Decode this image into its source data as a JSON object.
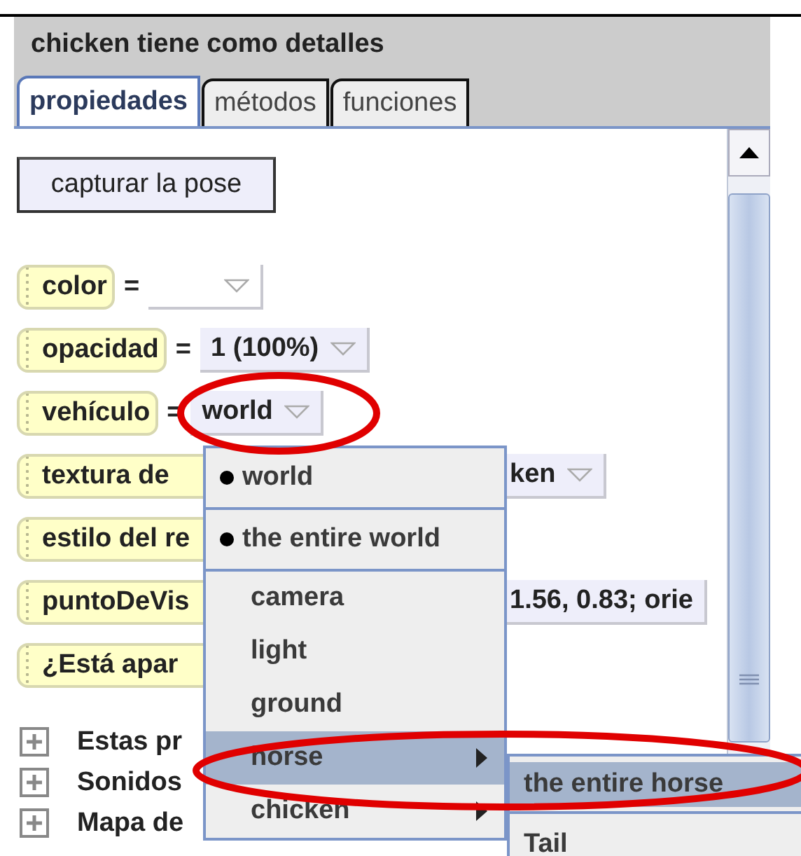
{
  "panel": {
    "title": "chicken tiene como detalles"
  },
  "tabs": [
    {
      "label": "propiedades",
      "selected": true
    },
    {
      "label": "métodos",
      "selected": false
    },
    {
      "label": "funciones",
      "selected": false
    }
  ],
  "capture_button": "capturar la pose",
  "properties": [
    {
      "name": "color",
      "equals": "=",
      "dropdown": true,
      "kind": "open"
    },
    {
      "name": "opacidad",
      "equals": "=",
      "value": "1 (100%)",
      "dropdown": true,
      "kind": "open"
    },
    {
      "name": "vehículo",
      "equals": "=",
      "value": "world",
      "dropdown": true,
      "kind": "open"
    },
    {
      "name": "textura de",
      "value": "ken",
      "dropdown": true,
      "kind": "covered"
    },
    {
      "name": "estilo del re",
      "dropdown": false,
      "kind": "covered"
    },
    {
      "name": "puntoDeVis",
      "value": "1.56, 0.83;  orie",
      "dropdown": false,
      "kind": "covered"
    },
    {
      "name": "¿Está apar",
      "dropdown": false,
      "kind": "covered"
    }
  ],
  "groups": [
    {
      "label": "Estas pr",
      "expanded": false
    },
    {
      "label": "Sonidos",
      "expanded": false
    },
    {
      "label": "Mapa de",
      "expanded": false
    }
  ],
  "menu": {
    "items": [
      {
        "label": "world",
        "kind": "radio",
        "selected": false,
        "separator_after": true
      },
      {
        "label": "the entire world",
        "kind": "radio",
        "selected": false,
        "separator_after": true
      },
      {
        "label": "camera",
        "kind": "plain",
        "selected": false,
        "separator_after": false
      },
      {
        "label": "light",
        "kind": "plain",
        "selected": false,
        "separator_after": false
      },
      {
        "label": "ground",
        "kind": "plain",
        "selected": false,
        "separator_after": false
      },
      {
        "label": "horse",
        "kind": "submenu",
        "selected": true,
        "separator_after": false
      },
      {
        "label": "chicken",
        "kind": "submenu",
        "selected": false,
        "separator_after": false
      }
    ]
  },
  "submenu": {
    "items": [
      {
        "label": "the entire horse",
        "selected": true,
        "separator_after": true
      },
      {
        "label": "Tail",
        "selected": false
      }
    ]
  }
}
